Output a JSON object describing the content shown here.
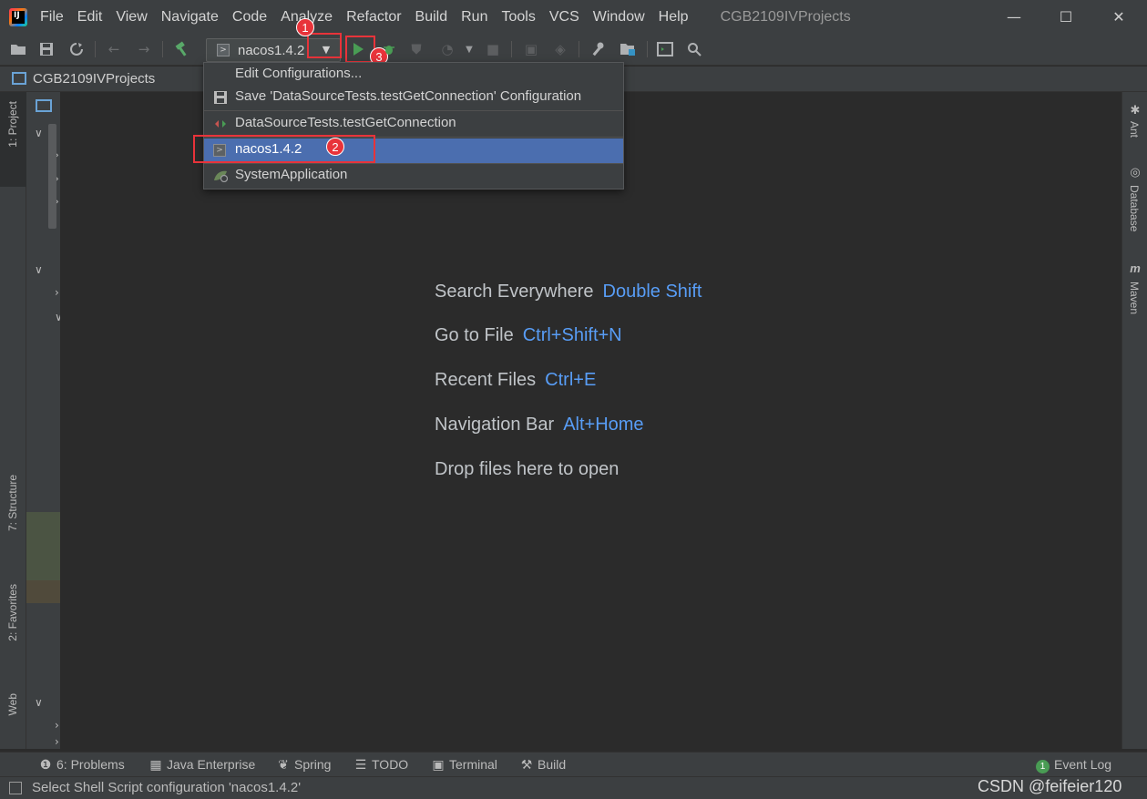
{
  "menubar": {
    "logo_text": "IJ",
    "items": [
      "File",
      "Edit",
      "View",
      "Navigate",
      "Code",
      "Analyze",
      "Refactor",
      "Build",
      "Run",
      "Tools",
      "VCS",
      "Window",
      "Help"
    ],
    "window_title": "CGB2109IVProjects",
    "minimize": "—",
    "maximize": "☐",
    "close": "✕"
  },
  "toolbar": {
    "run_config": "nacos1.4.2",
    "run_config_icon": ">",
    "dropdown_arrow": "▼"
  },
  "annotations": [
    "1",
    "2",
    "3"
  ],
  "navbar": {
    "project": "CGB2109IVProjects"
  },
  "left_tabs": {
    "project": "1: Project",
    "structure": "7: Structure",
    "favorites": "2: Favorites",
    "web": "Web"
  },
  "right_tabs": {
    "ant": "Ant",
    "database": "Database",
    "maven": "Maven"
  },
  "dropdown": {
    "items": [
      {
        "label": "Edit Configurations...",
        "icon": ""
      },
      {
        "label": "Save 'DataSourceTests.testGetConnection' Configuration",
        "icon": "save-icon"
      },
      {
        "label": "DataSourceTests.testGetConnection",
        "icon": "junit-icon"
      },
      {
        "label": "nacos1.4.2",
        "icon": "shell-icon"
      },
      {
        "label": "SystemApplication",
        "icon": "spring-boot-icon"
      }
    ]
  },
  "editor_hints": [
    {
      "text": "Search Everywhere",
      "key": "Double Shift"
    },
    {
      "text": "Go to File",
      "key": "Ctrl+Shift+N"
    },
    {
      "text": "Recent Files",
      "key": "Ctrl+E"
    },
    {
      "text": "Navigation Bar",
      "key": "Alt+Home"
    },
    {
      "text": "Drop files here to open",
      "key": ""
    }
  ],
  "bottom_bar": {
    "problems": "6: Problems",
    "java_enterprise": "Java Enterprise",
    "spring": "Spring",
    "todo": "TODO",
    "terminal": "Terminal",
    "build": "Build",
    "event_log": "Event Log",
    "event_count": "1"
  },
  "status_bar": {
    "text": "Select Shell Script configuration 'nacos1.4.2'",
    "watermark": "CSDN @feifeier120"
  },
  "colors": {
    "accent_key": "#589df6",
    "selection": "#4b6eaf",
    "annotation": "#e8333a",
    "run_green": "#499c54"
  }
}
